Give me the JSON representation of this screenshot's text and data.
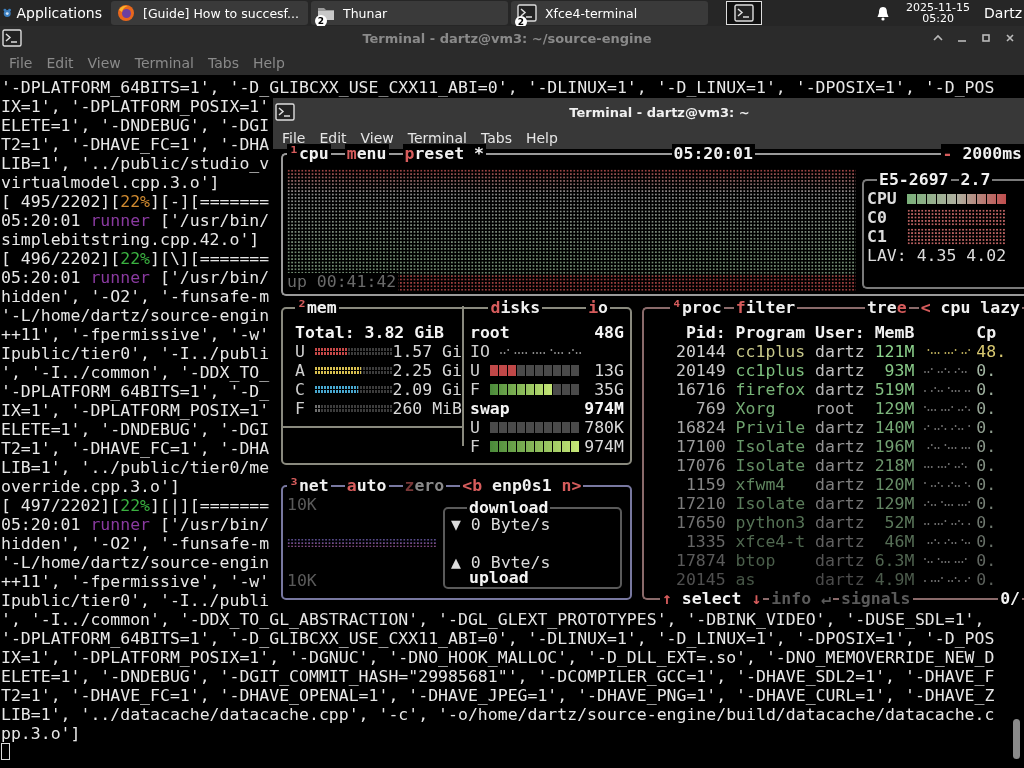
{
  "taskbar": {
    "app_menu": "Applications",
    "tasks": [
      {
        "kind": "browser",
        "title": "[Guide] How to succesf..."
      },
      {
        "kind": "files",
        "title": "Thunar",
        "badge": "2"
      },
      {
        "kind": "terminal",
        "title": "Xfce4-terminal",
        "badge": "2"
      }
    ],
    "clock": {
      "date": "2025-11-15",
      "time": "05:20"
    },
    "user": "Dartz"
  },
  "back_window": {
    "title": "Terminal - dartz@vm3: ~/source-engine",
    "menu": [
      "File",
      "Edit",
      "View",
      "Terminal",
      "Tabs",
      "Help"
    ],
    "lines": [
      "'-DPLATFORM_64BITS=1', '-D_GLIBCXX_USE_CXX11_ABI=0', '-DLINUX=1', '-D_LINUX=1', '-DPOSIX=1', '-D_POS",
      "IX=1', '-DPLATFORM_POSIX=1'",
      "ELETE=1', '-DNDEBUG', '-DGI",
      "T2=1', '-DHAVE_FC=1', '-DHA",
      "LIB=1', '../public/studio_v",
      "virtualmodel.cpp.3.o']",
      [
        "[ 495/2202][",
        {
          "text": "22%",
          "color": "#d08a30"
        },
        "][-][======="
      ],
      [
        "05:20:01 ",
        {
          "text": "runner",
          "color": "#8a3aa0"
        },
        " ['/usr/bin/"
      ],
      "simplebitstring.cpp.42.o']",
      [
        "[ 496/2202][",
        {
          "text": "22%",
          "color": "#3ab040"
        },
        "][\\][======="
      ],
      [
        "05:20:01 ",
        {
          "text": "runner",
          "color": "#8a3aa0"
        },
        " ['/usr/bin/"
      ],
      "hidden', '-O2', '-funsafe-m",
      "'-L/home/dartz/source-engin",
      "++11', '-fpermissive', '-w'",
      "Ipublic/tier0', '-I../publi",
      "', '-I../common', '-DDX_TO_",
      "'-DPLATFORM_64BITS=1', '-D_",
      "IX=1', '-DPLATFORM_POSIX=1'",
      "ELETE=1', '-DNDEBUG', '-DGI",
      "T2=1', '-DHAVE_FC=1', '-DHA",
      "LIB=1', '../public/tier0/me",
      "override.cpp.3.o']",
      [
        "[ 497/2202][",
        {
          "text": "22%",
          "color": "#3ab040"
        },
        "][|][======="
      ],
      [
        "05:20:01 ",
        {
          "text": "runner",
          "color": "#8a3aa0"
        },
        " ['/usr/bin/"
      ],
      "hidden', '-O2', '-funsafe-m",
      "'-L/home/dartz/source-engin",
      "++11', '-fpermissive', '-w'",
      "Ipublic/tier0', '-I../publi",
      "', '-I../common', '-DDX_TO_GL_ABSTRACTION', '-DGL_GLEXT_PROTOTYPES', '-DBINK_VIDEO', '-DUSE_SDL=1',",
      "'-DPLATFORM_64BITS=1', '-D_GLIBCXX_USE_CXX11_ABI=0', '-DLINUX=1', '-D_LINUX=1', '-DPOSIX=1', '-D_POS",
      "IX=1', '-DPLATFORM_POSIX=1', '-DGNUC', '-DNO_HOOK_MALLOC', '-D_DLL_EXT=.so', '-DNO_MEMOVERRIDE_NEW_D",
      "ELETE=1', '-DNDEBUG', '-DGIT_COMMIT_HASH=\"29985681\"', '-DCOMPILER_GCC=1', '-DHAVE_SDL2=1', '-DHAVE_F",
      "T2=1', '-DHAVE_FC=1', '-DHAVE_OPENAL=1', '-DHAVE_JPEG=1', '-DHAVE_PNG=1', '-DHAVE_CURL=1', '-DHAVE_Z",
      "LIB=1', '../datacache/datacache.cpp', '-c', '-o/home/dartz/source-engine/build/datacache/datacache.c",
      "pp.3.o']"
    ]
  },
  "front_window": {
    "title": "Terminal - dartz@vm3: ~",
    "menu": [
      "File",
      "Edit",
      "View",
      "Terminal",
      "Tabs",
      "Help"
    ],
    "btop": {
      "cpu": {
        "tabs": [
          [
            {
              "text": "¹",
              "color": "#d65c5c"
            },
            "cpu"
          ],
          [
            {
              "text": "m",
              "color": "#d65c5c"
            },
            "enu"
          ],
          [
            {
              "text": "p",
              "color": "#d65c5c"
            },
            "reset *"
          ]
        ],
        "clock": "05:20:01",
        "interval": [
          {
            "text": "-",
            "color": "#d65c5c"
          },
          " 2000ms"
        ],
        "uptime": "up 00:41:42",
        "model": "E5-2697",
        "freq": "2.7",
        "rows": [
          {
            "kind": "meter",
            "label": "CPU",
            "level": 1
          },
          {
            "kind": "graph",
            "label": "C0"
          },
          {
            "kind": "graph",
            "label": "C1"
          }
        ],
        "load": "LAV: 4.35 4.02"
      },
      "mem": {
        "tabs": [
          [
            {
              "text": "²",
              "color": "#d65c5c"
            },
            "mem"
          ]
        ],
        "total": "Total: 3.82 GiB",
        "rows": [
          {
            "label": "U",
            "value": "1.57 Gi",
            "level": 0.41,
            "color": "#c84848"
          },
          {
            "label": "A",
            "value": "2.25 Gi",
            "level": 0.59,
            "color": "#d8c050"
          },
          {
            "label": "C",
            "value": "2.09 Gi",
            "level": 0.55,
            "color": "#48a8d0"
          },
          {
            "label": "F",
            "value": "260 MiB",
            "level": 0.07,
            "color": "#707070"
          }
        ]
      },
      "disks": {
        "tabs": [
          [
            {
              "text": "d",
              "color": "#d65c5c"
            },
            "isks"
          ],
          [
            {
              "text": "i",
              "color": "#d65c5c"
            },
            "o"
          ]
        ],
        "sections": [
          {
            "name": "root",
            "size": "48G",
            "rows": [
              {
                "kind": "io",
                "label": "IO"
              },
              {
                "kind": "used",
                "label": "U",
                "value": "13G",
                "level": 0.3
              },
              {
                "kind": "free",
                "label": "F",
                "value": "35G",
                "level": 0.7
              }
            ]
          },
          {
            "name": "swap",
            "size": "974M",
            "rows": [
              {
                "kind": "used",
                "label": "U",
                "value": "780K",
                "level": 0
              },
              {
                "kind": "free",
                "label": "F",
                "value": "974M",
                "level": 1
              }
            ]
          }
        ]
      },
      "net": {
        "tabs": [
          [
            {
              "text": "³",
              "color": "#d65c5c"
            },
            "net"
          ],
          [
            {
              "text": "a",
              "color": "#d65c5c"
            },
            "uto"
          ],
          [
            {
              "text": "z",
              "color": "#7a3838"
            },
            {
              "text": "ero",
              "color": "#8a8a8a"
            }
          ],
          [
            {
              "text": "<b",
              "color": "#d65c5c"
            },
            " enp0s1 ",
            {
              "text": "n>",
              "color": "#d65c5c"
            }
          ]
        ],
        "scale_top": "10K",
        "scale_bottom": "10K",
        "download": {
          "label": "download",
          "arrow": "▼",
          "rate": "0 Byte/s"
        },
        "upload": {
          "label": "upload",
          "arrow": "▲",
          "rate": "0 Byte/s"
        }
      },
      "proc": {
        "tabs": [
          [
            {
              "text": "⁴",
              "color": "#d65c5c"
            },
            "proc"
          ],
          [
            {
              "text": "f",
              "color": "#d65c5c"
            },
            "ilter"
          ],
          [
            "tre",
            {
              "text": "e",
              "color": "#d65c5c"
            }
          ],
          [
            {
              "text": "<",
              "color": "#d65c5c"
            },
            " cpu lazy"
          ]
        ],
        "columns": [
          "Pid:",
          "Program",
          "User:",
          "MemB",
          "Cp"
        ],
        "rows": [
          {
            "pid": "20144",
            "program": "cc1plus",
            "user": "dartz",
            "mem": "121M",
            "cpu": "48."
          },
          {
            "pid": "20149",
            "program": "cc1plus",
            "user": "dartz",
            "mem": "93M",
            "cpu": "0."
          },
          {
            "pid": "16716",
            "program": "firefox",
            "user": "dartz",
            "mem": "519M",
            "cpu": "0."
          },
          {
            "pid": "769",
            "program": "Xorg",
            "user": "root",
            "mem": "129M",
            "cpu": "0."
          },
          {
            "pid": "16824",
            "program": "Privile",
            "user": "dartz",
            "mem": "140M",
            "cpu": "0."
          },
          {
            "pid": "17100",
            "program": "Isolate",
            "user": "dartz",
            "mem": "196M",
            "cpu": "0."
          },
          {
            "pid": "17076",
            "program": "Isolate",
            "user": "dartz",
            "mem": "218M",
            "cpu": "0."
          },
          {
            "pid": "1159",
            "program": "xfwm4",
            "user": "dartz",
            "mem": "120M",
            "cpu": "0."
          },
          {
            "pid": "17210",
            "program": "Isolate",
            "user": "dartz",
            "mem": "129M",
            "cpu": "0."
          },
          {
            "pid": "17650",
            "program": "python3",
            "user": "dartz",
            "mem": "52M",
            "cpu": "0."
          },
          {
            "pid": "1335",
            "program": "xfce4-t",
            "user": "dartz",
            "mem": "46M",
            "cpu": "0."
          },
          {
            "pid": "17874",
            "program": "btop",
            "user": "dartz",
            "mem": "6.3M",
            "cpu": "0."
          },
          {
            "pid": "20145",
            "program": "as",
            "user": "dartz",
            "mem": "4.9M",
            "cpu": "0."
          }
        ],
        "footer": [
          [
            {
              "text": "↑",
              "color": "#d65c5c"
            },
            " select ",
            {
              "text": "↓",
              "color": "#d65c5c"
            }
          ],
          [
            {
              "text": "info ↵",
              "color": "#5a5a5a"
            }
          ],
          [
            {
              "text": "signals",
              "color": "#5a5a5a"
            }
          ]
        ],
        "count": "0/"
      }
    }
  }
}
